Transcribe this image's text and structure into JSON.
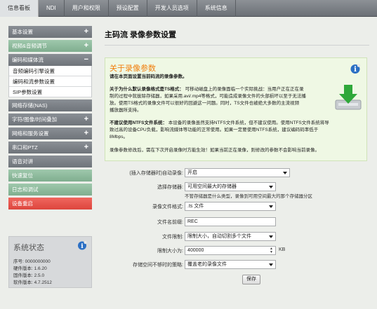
{
  "topnav": {
    "tabs": [
      {
        "label": "信息看板",
        "active": true
      },
      {
        "label": "NDI",
        "active": false
      },
      {
        "label": "用户和权限",
        "active": false
      },
      {
        "label": "预设配置",
        "active": false
      },
      {
        "label": "开发人员选项",
        "active": false
      },
      {
        "label": "系统信息",
        "active": false
      }
    ]
  },
  "sidebar": {
    "items": [
      {
        "label": "基本设置",
        "sign": "+",
        "style": "gray"
      },
      {
        "label": "视频&音频调节",
        "sign": "+",
        "style": "green"
      },
      {
        "label": "编码和媒体流",
        "sign": "−",
        "style": "gray"
      }
    ],
    "subitems": [
      "音频编码引擎设置",
      "编码和流参数设置",
      "SIP参数设置"
    ],
    "items2": [
      {
        "label": "网络存储(NAS)",
        "sign": "",
        "style": "gray"
      },
      {
        "label": "字符/图像/时间叠加",
        "sign": "+",
        "style": "gray"
      },
      {
        "label": "网络和服务设置",
        "sign": "+",
        "style": "gray"
      },
      {
        "label": "串口和PTZ",
        "sign": "+",
        "style": "gray"
      },
      {
        "label": "语音对讲",
        "sign": "",
        "style": "gray"
      },
      {
        "label": "快速复位",
        "sign": "",
        "style": "green"
      },
      {
        "label": "日志和调试",
        "sign": "",
        "style": "green"
      },
      {
        "label": "设备重启",
        "sign": "",
        "style": "red"
      }
    ]
  },
  "status": {
    "title": "系统状态",
    "serial_label": "序号:",
    "serial_value": "0000000000",
    "hw_label": "硬件版本:",
    "hw_value": "1.6.20",
    "fw_label": "固件版本:",
    "fw_value": "2.5.0",
    "sw_label": "软件版本:",
    "sw_value": "4.7.2512"
  },
  "main": {
    "title": "主码流 录像参数设置"
  },
  "info": {
    "title": "关于录像参数",
    "intro": "请在本页面设置当前码流的录像参数。",
    "p1_bold": "关于为什么默认录像格式是TS格式：",
    "p1_line1": "可移动磁盘上的录像面临一个实际挑战：当用户正在正在录",
    "p1_line2": "制的过程中就拔除存储器，如果采用.avi/.mp4等格式，可能造成录像文件的头部损坏以至于无法播",
    "p1_line3": "放。使用TS格式的录像文件可以很好的回避这一问题。同时，TS文件也被绝大多数的主流视频",
    "p1_line4": "播放器所支持。",
    "p2_bold": "不建议使用NTFS文件系统：",
    "p2_line1": "本设备的录像虽然支持NTFS文件系统，但不建议使用。使用NTFS文件系统将导",
    "p2_line2": "致过高的设备CPU负载，影响流媒体等功能的正常使用。如果一定要使用NTFS系统，建议编码码率低于",
    "p2_line3": "8Mbps。",
    "p3": "录像参数修改后，需在下次开启录像时方能生效！如果当前正在录像，则修改的参数不会影响当前录像。"
  },
  "form": {
    "autorecord_label": "(插入存储器时)自动录像:",
    "autorecord_value": "开启",
    "storage_label": "选择存储器:",
    "storage_value": "可用空间最大的存储器",
    "storage_hint": "不管存储器是什么类型，录像到可用空间最大的那个存储器分区",
    "format_label": "录像文件格式:",
    "format_value": ".ts 文件",
    "prefix_label": "文件名前缀:",
    "prefix_value": "REC",
    "limit_label": "文件限制:",
    "limit_value": "限制大小，自动切割多个文件",
    "size_label": "限制大小为:",
    "size_value": "400000",
    "size_unit": "KB",
    "policy_label": "存储空间不够时的策略:",
    "policy_value": "覆盖老的录像文件",
    "save_label": "保存"
  }
}
